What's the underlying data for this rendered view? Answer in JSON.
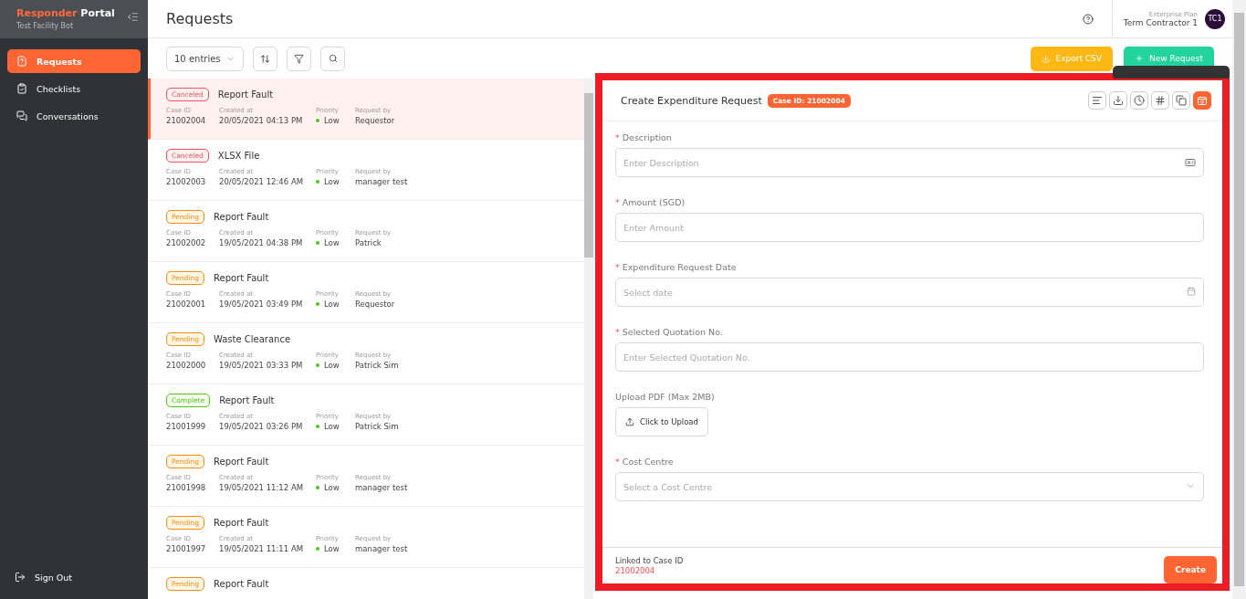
{
  "brand": {
    "first": "Responder",
    "second": "Portal",
    "subtitle": "Test Facility Bot"
  },
  "nav": [
    {
      "kind": "requests",
      "label": "Requests",
      "selected": true
    },
    {
      "kind": "checklists",
      "label": "Checklists",
      "selected": false
    },
    {
      "kind": "conversations",
      "label": "Conversations",
      "selected": false
    }
  ],
  "sign_out": "Sign Out",
  "page_title": "Requests",
  "account": {
    "plan": "Enterprise Plan",
    "name": "Term Contractor 1",
    "initials": "TC1"
  },
  "toolbar": {
    "entries": "10 entries",
    "export": "Export CSV",
    "new_request": "New Request"
  },
  "requests": [
    {
      "status": {
        "kind": "canceled",
        "label": "Canceled"
      },
      "title": "Report Fault",
      "selected": true,
      "case_label": "Case ID",
      "case_id": "21002004",
      "created_label": "Created at",
      "created": "20/05/2021 04:13 PM",
      "priority_label": "Priority",
      "priority": "Low",
      "by_label": "Request by",
      "by": "Requestor"
    },
    {
      "status": {
        "kind": "canceled",
        "label": "Canceled"
      },
      "title": "XLSX File",
      "selected": false,
      "case_label": "Case ID",
      "case_id": "21002003",
      "created_label": "Created at",
      "created": "20/05/2021 12:46 AM",
      "priority_label": "Priority",
      "priority": "Low",
      "by_label": "Request by",
      "by": "manager test"
    },
    {
      "status": {
        "kind": "pending",
        "label": "Pending"
      },
      "title": "Report Fault",
      "selected": false,
      "case_label": "Case ID",
      "case_id": "21002002",
      "created_label": "Created at",
      "created": "19/05/2021 04:38 PM",
      "priority_label": "Priority",
      "priority": "Low",
      "by_label": "Request by",
      "by": "Patrick"
    },
    {
      "status": {
        "kind": "pending",
        "label": "Pending"
      },
      "title": "Report Fault",
      "selected": false,
      "case_label": "Case ID",
      "case_id": "21002001",
      "created_label": "Created at",
      "created": "19/05/2021 03:49 PM",
      "priority_label": "Priority",
      "priority": "Low",
      "by_label": "Request by",
      "by": "Requestor"
    },
    {
      "status": {
        "kind": "pending",
        "label": "Pending"
      },
      "title": "Waste Clearance",
      "selected": false,
      "case_label": "Case ID",
      "case_id": "21002000",
      "created_label": "Created at",
      "created": "19/05/2021 03:33 PM",
      "priority_label": "Priority",
      "priority": "Low",
      "by_label": "Request by",
      "by": "Patrick Sim"
    },
    {
      "status": {
        "kind": "complete",
        "label": "Complete"
      },
      "title": "Report Fault",
      "selected": false,
      "case_label": "Case ID",
      "case_id": "21001999",
      "created_label": "Created at",
      "created": "19/05/2021 03:26 PM",
      "priority_label": "Priority",
      "priority": "Low",
      "by_label": "Request by",
      "by": "Patrick Sim"
    },
    {
      "status": {
        "kind": "pending",
        "label": "Pending"
      },
      "title": "Report Fault",
      "selected": false,
      "case_label": "Case ID",
      "case_id": "21001998",
      "created_label": "Created at",
      "created": "19/05/2021 11:12 AM",
      "priority_label": "Priority",
      "priority": "Low",
      "by_label": "Request by",
      "by": "manager test"
    },
    {
      "status": {
        "kind": "pending",
        "label": "Pending"
      },
      "title": "Report Fault",
      "selected": false,
      "case_label": "Case ID",
      "case_id": "21001997",
      "created_label": "Created at",
      "created": "19/05/2021 11:11 AM",
      "priority_label": "Priority",
      "priority": "Low",
      "by_label": "Request by",
      "by": "manager test"
    },
    {
      "status": {
        "kind": "pending",
        "label": "Pending"
      },
      "title": "Report Fault",
      "selected": false
    }
  ],
  "panel": {
    "title": "Create Expenditure Request",
    "case_badge": "Case ID: 21002004",
    "tools": [
      {
        "kind": "lines",
        "selected": false
      },
      {
        "kind": "tray",
        "selected": false
      },
      {
        "kind": "clock",
        "selected": false
      },
      {
        "kind": "hash",
        "selected": false
      },
      {
        "kind": "copy",
        "selected": false
      },
      {
        "kind": "camera",
        "selected": true
      }
    ],
    "fields": [
      {
        "kind": "text",
        "marker": "*",
        "label": "Description",
        "placeholder": "Enter Description"
      },
      {
        "kind": "text",
        "marker": "*",
        "label": "Amount (SGD)",
        "placeholder": "Enter Amount"
      },
      {
        "kind": "date",
        "marker": "*",
        "label": "Expenditure Request Date",
        "placeholder": "Select date"
      },
      {
        "kind": "text",
        "marker": "*",
        "label": "Selected Quotation No.",
        "placeholder": "Enter Selected Quotation No."
      },
      {
        "kind": "upload",
        "label": "Upload PDF (Max 2MB)",
        "button": "Click to Upload"
      },
      {
        "kind": "select",
        "marker": "*",
        "label": "Cost Centre",
        "placeholder": "Select a Cost Centre"
      }
    ],
    "linked_label": "Linked to Case ID",
    "linked_id": "21002004",
    "create": "Create"
  }
}
